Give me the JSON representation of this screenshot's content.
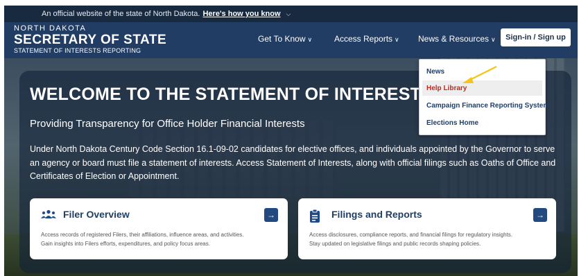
{
  "gov_banner": {
    "text": "An official website of the state of North Dakota.",
    "link": "Here's how you know",
    "chevron_icon": "chevron-down-icon"
  },
  "logo": {
    "line1": "NORTH DAKOTA",
    "line2": "SECRETARY OF STATE",
    "line3": "STATEMENT OF INTERESTS REPORTING"
  },
  "nav": {
    "items": [
      {
        "label": "Get To Know"
      },
      {
        "label": "Access Reports"
      },
      {
        "label": "News & Resources"
      }
    ],
    "signin_label": "Sign-in / Sign up"
  },
  "dropdown": {
    "items": [
      {
        "label": "News",
        "highlighted": false
      },
      {
        "label": "Help Library",
        "highlighted": true
      },
      {
        "label": "Campaign Finance Reporting System",
        "highlighted": false
      },
      {
        "label": "Elections Home",
        "highlighted": false
      }
    ]
  },
  "hero": {
    "title": "WELCOME TO THE STATEMENT OF INTERESTS REP",
    "subtitle": "Providing Transparency for Office Holder Financial Interests",
    "body": "Under North Dakota Century Code Section 16.1-09-02 candidates for elective offices, and individuals appointed by the Governor to serve an agency or board must file a statement of interests. Access Statement of Interests, along with official filings such as Oaths of Office and Certificates of Election or Appointment."
  },
  "cards": [
    {
      "title": "Filer Overview",
      "icon": "users-icon",
      "desc1": "Access records of registered Filers, their affiliations, influence areas, and activities.",
      "desc2": "Gain insights into Filers efforts, expenditures, and policy focus areas."
    },
    {
      "title": "Filings and Reports",
      "icon": "document-icon",
      "desc1": "Access disclosures, compliance reports, and financial filings for regulatory insights.",
      "desc2": "Stay updated on legislative filings and public records shaping policies."
    }
  ],
  "colors": {
    "header": "#223d63",
    "accent": "#224a80",
    "highlight_text": "#c2281b",
    "annotation_arrow": "#f5c518"
  }
}
